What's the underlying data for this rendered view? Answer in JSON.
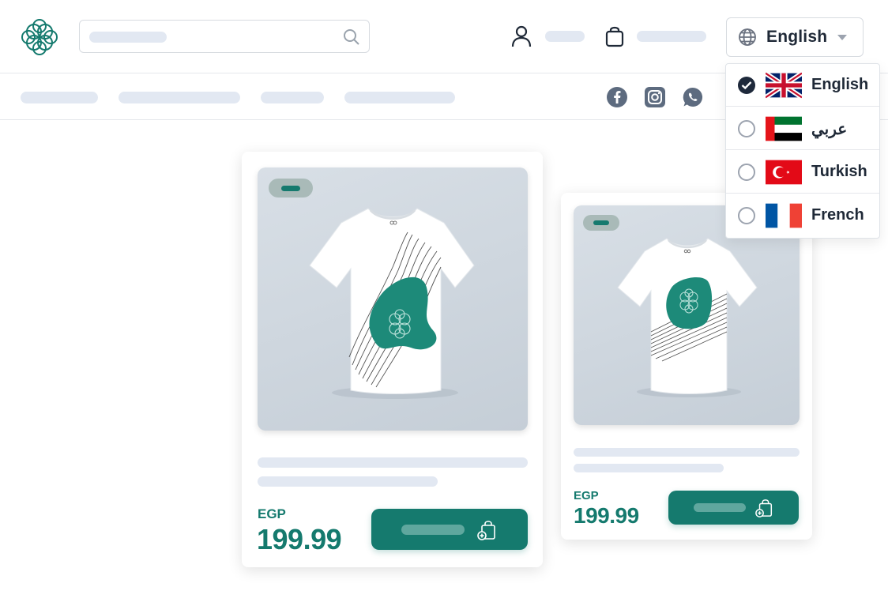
{
  "language": {
    "selected": "English",
    "options": [
      {
        "label": "English",
        "checked": true,
        "flag": "uk-flag-icon"
      },
      {
        "label": "عربي",
        "checked": false,
        "flag": "uae-flag-icon"
      },
      {
        "label": "Turkish",
        "checked": false,
        "flag": "turkey-flag-icon"
      },
      {
        "label": "French",
        "checked": false,
        "flag": "france-flag-icon"
      }
    ]
  },
  "products": [
    {
      "currency": "EGP",
      "price": "199.99"
    },
    {
      "currency": "EGP",
      "price": "199.99"
    }
  ],
  "icons": [
    "logo-icon",
    "search-icon",
    "user-icon",
    "bag-icon",
    "globe-icon",
    "caret-down-icon",
    "facebook-icon",
    "instagram-icon",
    "whatsapp-icon",
    "add-to-cart-icon"
  ],
  "colors": {
    "brand": "#157a6e",
    "placeholder": "#e2e8f2",
    "social": "#5d6b7f"
  }
}
